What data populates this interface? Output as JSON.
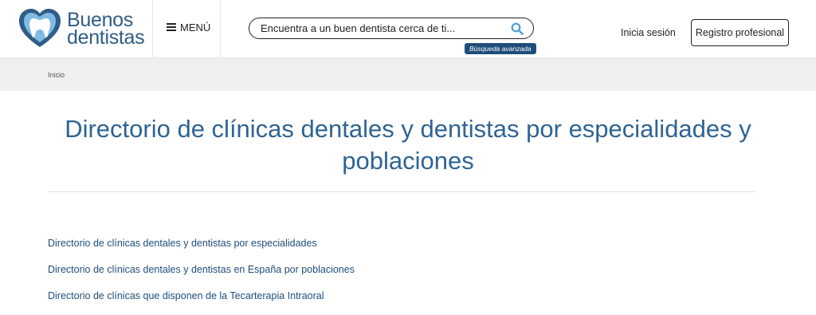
{
  "header": {
    "logo": {
      "line1": "Buenos",
      "line2": "dentistas"
    },
    "menu_label": "MENÚ",
    "search": {
      "placeholder": "Encuentra a un buen dentista cerca de ti...",
      "value": ""
    },
    "advanced_search_label": "Búsqueda avanzada",
    "login_label": "Inicia sesión",
    "register_label": "Registro profesional"
  },
  "breadcrumb": {
    "home": "Inicio"
  },
  "main": {
    "title": "Directorio de clínicas dentales y dentistas por especialidades y poblaciones",
    "links": [
      "Directorio de clínicas dentales y dentistas por especialidades",
      "Directorio de clínicas dentales y dentistas en España por poblaciones",
      "Directorio de clínicas que disponen de la Tecarterapia Intraoral"
    ]
  },
  "colors": {
    "brand_blue": "#2f5d86",
    "title_blue": "#2f6494",
    "link_blue": "#1f4d7a",
    "badge_blue": "#1f4d7a",
    "breadcrumb_bg": "#efefef",
    "search_icon": "#4a9fd8"
  },
  "icons": {
    "logo": "tooth-heart-icon",
    "menu": "hamburger-icon",
    "search": "search-icon"
  }
}
